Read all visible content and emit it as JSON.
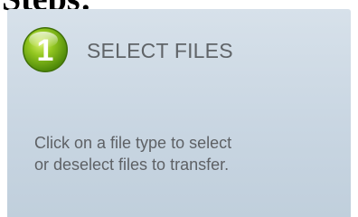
{
  "page": {
    "heading_fragment": "Steps:"
  },
  "step": {
    "number": "1",
    "title": "SELECT FILES",
    "instruction_line1": "Click on a file type to select",
    "instruction_line2": "or deselect files to transfer.",
    "badge_color": "#7fb51a",
    "badge_icon": "green-circle-number-icon"
  },
  "colors": {
    "panel_top": "#d7e1ea",
    "panel_bottom": "#c0cfdc",
    "title_text": "#606468",
    "body_text": "#5e6165"
  }
}
